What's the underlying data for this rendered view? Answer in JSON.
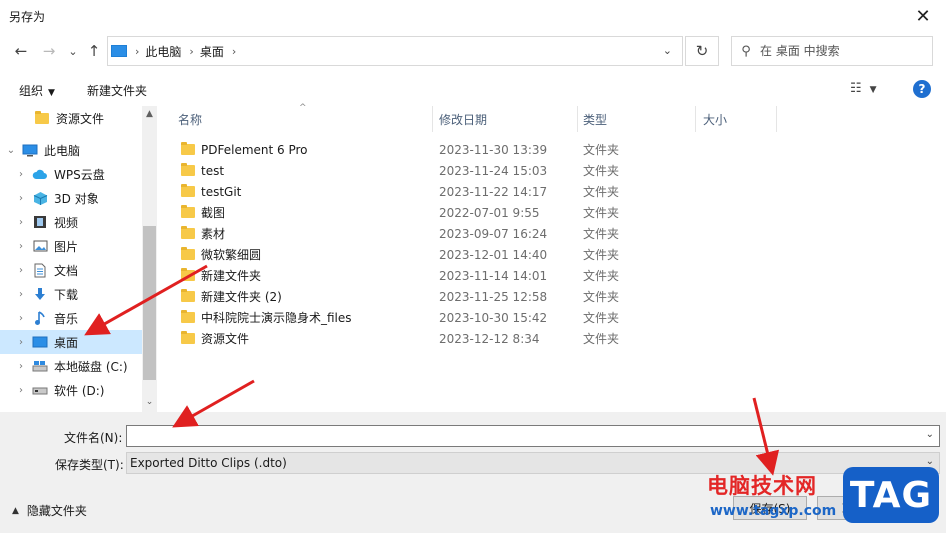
{
  "window": {
    "title": "另存为",
    "close_glyph": "✕"
  },
  "nav": {
    "back_glyph": "←",
    "forward_glyph": "→",
    "recent_glyph": "⌄",
    "up_glyph": "↑",
    "breadcrumb": [
      "此电脑",
      "桌面"
    ],
    "address_dropdown": "⌄",
    "refresh_glyph": "↻",
    "search_placeholder": "在 桌面 中搜索",
    "search_icon": "⚲"
  },
  "toolbar": {
    "organize_label": "组织",
    "organize_arrow": "▼",
    "new_folder_label": "新建文件夹",
    "view_glyph": "☷",
    "view_arrow": "▼",
    "help_glyph": "?"
  },
  "sidebar": {
    "items": [
      {
        "label": "资源文件",
        "icon": "folder-icon",
        "expander": ""
      },
      {
        "label": "此电脑",
        "icon": "pc-icon",
        "expander": "⌄"
      },
      {
        "label": "WPS云盘",
        "icon": "cloud-icon",
        "expander": "›"
      },
      {
        "label": "3D 对象",
        "icon": "cube-icon",
        "expander": "›"
      },
      {
        "label": "视频",
        "icon": "video-icon",
        "expander": "›"
      },
      {
        "label": "图片",
        "icon": "picture-icon",
        "expander": "›"
      },
      {
        "label": "文档",
        "icon": "document-icon",
        "expander": "›"
      },
      {
        "label": "下载",
        "icon": "download-icon",
        "expander": "›"
      },
      {
        "label": "音乐",
        "icon": "music-icon",
        "expander": "›"
      },
      {
        "label": "桌面",
        "icon": "desktop-icon",
        "expander": "›",
        "selected": true
      },
      {
        "label": "本地磁盘 (C:)",
        "icon": "drive-icon",
        "expander": "›"
      },
      {
        "label": "软件 (D:)",
        "icon": "drive-icon",
        "expander": "›"
      }
    ],
    "scroll_up": "▲",
    "scroll_down": "⌄"
  },
  "columns": {
    "name": "名称",
    "date": "修改日期",
    "type": "类型",
    "size": "大小",
    "sort_caret": "^"
  },
  "files": [
    {
      "name": "PDFelement 6 Pro",
      "date": "2023-11-30 13:39",
      "type": "文件夹"
    },
    {
      "name": "test",
      "date": "2023-11-24 15:03",
      "type": "文件夹"
    },
    {
      "name": "testGit",
      "date": "2023-11-22 14:17",
      "type": "文件夹"
    },
    {
      "name": "截图",
      "date": "2022-07-01 9:55",
      "type": "文件夹"
    },
    {
      "name": "素材",
      "date": "2023-09-07 16:24",
      "type": "文件夹"
    },
    {
      "name": "微软繁细圆",
      "date": "2023-12-01 14:40",
      "type": "文件夹"
    },
    {
      "name": "新建文件夹",
      "date": "2023-11-14 14:01",
      "type": "文件夹"
    },
    {
      "name": "新建文件夹 (2)",
      "date": "2023-11-25 12:58",
      "type": "文件夹"
    },
    {
      "name": "中科院院士演示隐身术_files",
      "date": "2023-10-30 15:42",
      "type": "文件夹"
    },
    {
      "name": "资源文件",
      "date": "2023-12-12 8:34",
      "type": "文件夹"
    }
  ],
  "form": {
    "filename_label": "文件名(N):",
    "filename_value": "",
    "filetype_label": "保存类型(T):",
    "filetype_value": "Exported Ditto Clips (.dto)",
    "dropdown_glyph": "⌄",
    "hide_folders_label": "隐藏文件夹",
    "hide_folders_caret": "▲",
    "save_label": "保存(S)",
    "cancel_label": "取消"
  },
  "watermark": {
    "site_cn": "电脑技术网",
    "url": "www.tagxp.com",
    "tag": "TAG"
  },
  "colors": {
    "selected_bg": "#cce8ff",
    "folder": "#f7c948",
    "annotation_arrow": "#e02020",
    "help": "#1f6fd0"
  }
}
